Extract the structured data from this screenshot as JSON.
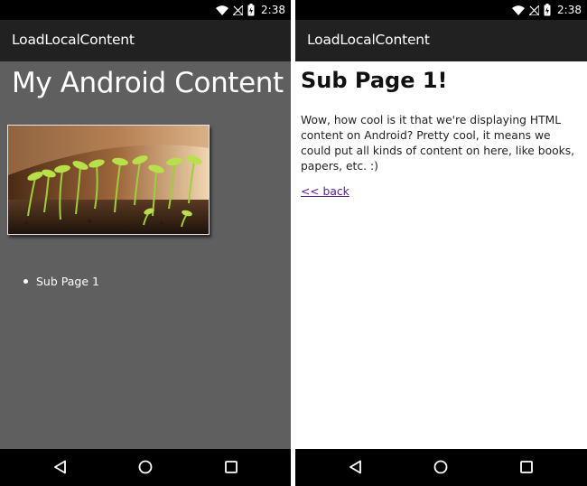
{
  "status_bar": {
    "time": "2:38",
    "icons": [
      "wifi-icon",
      "no-signal-icon",
      "battery-charging-icon"
    ]
  },
  "left_screen": {
    "app_title": "LoadLocalContent",
    "heading": "My Android Content",
    "image": "sprouts-photo",
    "list_items": [
      {
        "label": "Sub Page 1"
      }
    ],
    "colors": {
      "page_background": "#5f5f5f",
      "app_bar": "#212121"
    }
  },
  "right_screen": {
    "app_title": "LoadLocalContent",
    "heading": "Sub Page 1!",
    "paragraph": "Wow, how cool is it that we're displaying HTML content on Android? Pretty cool, it means we could put all kinds of content on here, like books, papers, etc. :)",
    "back_link": "<< back",
    "colors": {
      "page_background": "#ffffff",
      "visited_link": "#551a8b"
    }
  },
  "nav_bar": {
    "buttons": [
      "back-icon",
      "home-icon",
      "recents-icon"
    ]
  }
}
